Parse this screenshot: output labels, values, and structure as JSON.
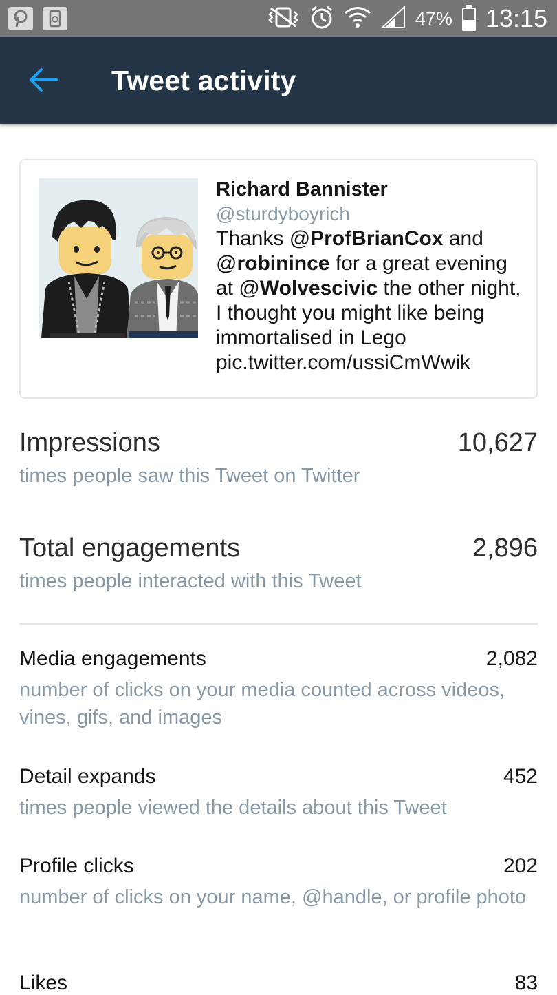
{
  "status_bar": {
    "battery_percent": "47%",
    "battery_level": 0.47,
    "time": "13:15",
    "icons": [
      "pinterest-icon",
      "recycle-icon",
      "vibrate-icon",
      "alarm-icon",
      "wifi-icon",
      "signal-icon",
      "battery-icon"
    ]
  },
  "header": {
    "back_icon": "arrow-left-icon",
    "title": "Tweet activity",
    "accent_color": "#1da1f2",
    "background_color": "#243447"
  },
  "tweet": {
    "author_name": "Richard Bannister",
    "author_handle": "@sturdyboyrich",
    "text": {
      "p1": "Thanks @",
      "m1": "ProfBrianCox",
      "p2": " and @",
      "m2": "robinince",
      "p3": " for a great evening at @",
      "m3": "Wolvescivic",
      "p4": " the other night, I thought you might like being immortalised in Lego pic.twitter.com/ussiCmWwik"
    },
    "media_alt": "lego-minifigures-image"
  },
  "metrics": {
    "impressions": {
      "label": "Impressions",
      "value": "10,627",
      "desc": "times people saw this Tweet on Twitter"
    },
    "total_engagements": {
      "label": "Total engagements",
      "value": "2,896",
      "desc": "times people interacted with this Tweet"
    },
    "media_engagements": {
      "label": "Media engagements",
      "value": "2,082",
      "desc": "number of clicks on your media counted across videos, vines, gifs, and images"
    },
    "detail_expands": {
      "label": "Detail expands",
      "value": "452",
      "desc": "times people viewed the details about this Tweet"
    },
    "profile_clicks": {
      "label": "Profile clicks",
      "value": "202",
      "desc": "number of clicks on your name, @handle, or profile photo"
    },
    "likes": {
      "label": "Likes",
      "value": "83"
    }
  }
}
